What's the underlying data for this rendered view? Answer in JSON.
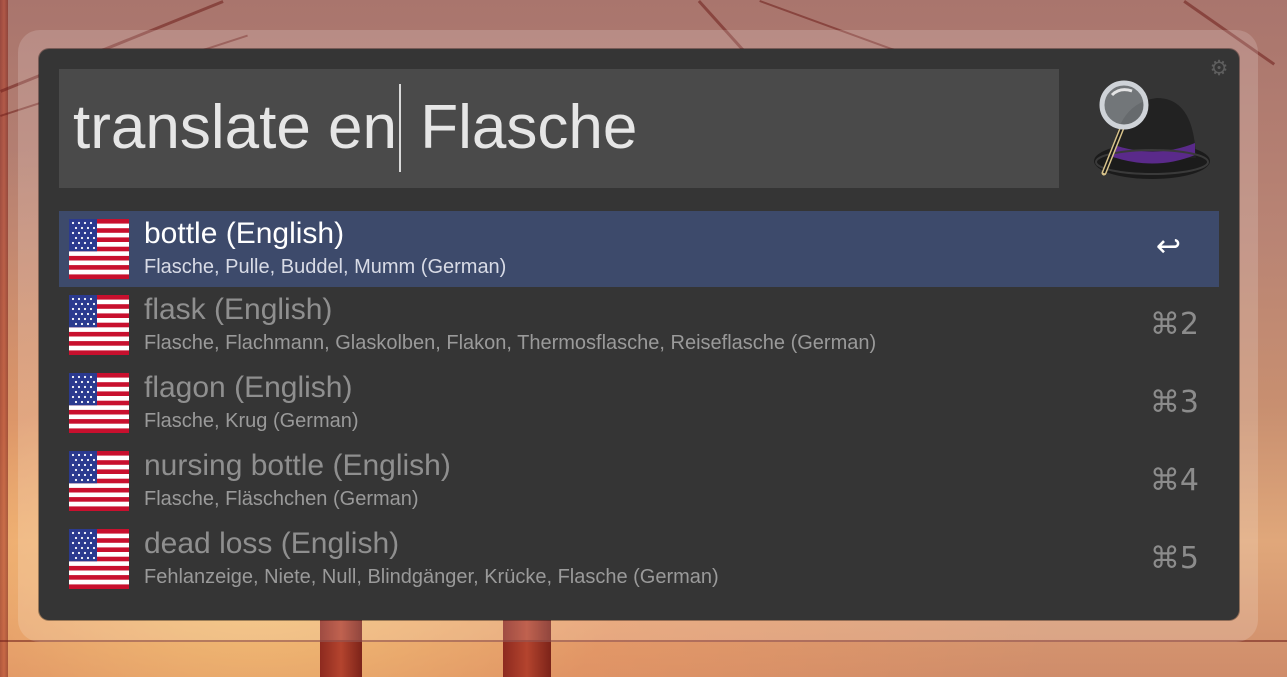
{
  "search": {
    "query_before_cursor": "translate en",
    "query_after_cursor": " Flasche"
  },
  "settings_icon": "gear-icon",
  "app_logo": "alfred-hat-logo",
  "results": [
    {
      "title": "bottle (English)",
      "subtitle": "Flasche, Pulle, Buddel, Mumm (German)",
      "shortcut": "↩",
      "selected": true,
      "icon": "us-flag-icon"
    },
    {
      "title": "flask (English)",
      "subtitle": "Flasche, Flachmann, Glaskolben, Flakon, Thermosflasche, Reiseflasche (German)",
      "shortcut": "⌘2",
      "selected": false,
      "icon": "us-flag-icon"
    },
    {
      "title": "flagon (English)",
      "subtitle": "Flasche, Krug (German)",
      "shortcut": "⌘3",
      "selected": false,
      "icon": "us-flag-icon"
    },
    {
      "title": "nursing bottle (English)",
      "subtitle": "Flasche, Fläschchen (German)",
      "shortcut": "⌘4",
      "selected": false,
      "icon": "us-flag-icon"
    },
    {
      "title": "dead loss (English)",
      "subtitle": "Fehlanzeige, Niete, Null, Blindgänger, Krücke, Flasche (German)",
      "shortcut": "⌘5",
      "selected": false,
      "icon": "us-flag-icon"
    }
  ],
  "colors": {
    "panel_bg": "#353535",
    "search_bg": "#4a4a4a",
    "selected_row_bg": "#3d4a6b",
    "title_text": "#8f8f8f",
    "selected_title_text": "#ffffff"
  }
}
